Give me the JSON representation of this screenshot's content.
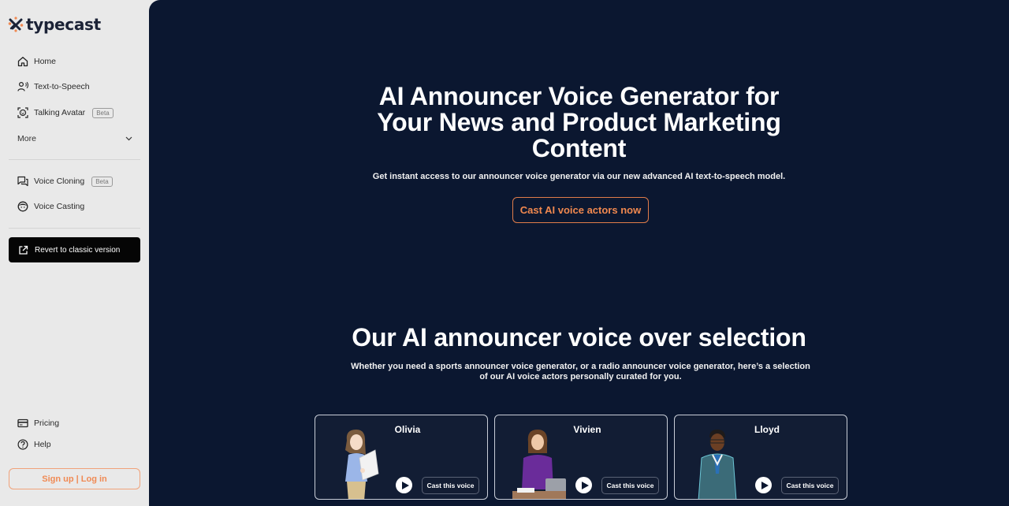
{
  "brand": {
    "name": "typecast",
    "accent": "#f08a54",
    "dark_bg": "#0b1730"
  },
  "sidebar": {
    "primary_items": [
      {
        "label": "Home",
        "icon": "home-icon"
      },
      {
        "label": "Text-to-Speech",
        "icon": "speaker-person-icon"
      },
      {
        "label": "Talking Avatar",
        "icon": "face-scan-icon",
        "badge": "Beta"
      }
    ],
    "more_label": "More",
    "secondary_items": [
      {
        "label": "Voice Cloning",
        "icon": "chat-bubbles-icon",
        "badge": "Beta"
      },
      {
        "label": "Voice Casting",
        "icon": "face-icon"
      }
    ],
    "revert_label": "Revert to classic version",
    "bottom_items": [
      {
        "label": "Pricing",
        "icon": "credit-card-icon"
      },
      {
        "label": "Help",
        "icon": "help-circle-icon"
      }
    ],
    "auth_label": "Sign up | Log in"
  },
  "hero": {
    "title_lines": [
      "AI Announcer Voice Generator for",
      "Your News and Product Marketing",
      "Content"
    ],
    "subtitle": "Get instant access to our announcer voice generator via our new advanced AI text-to-speech model.",
    "cta_label": "Cast AI voice actors now"
  },
  "selection": {
    "title": "Our AI announcer voice over selection",
    "subtitle": "Whether you need a sports announcer voice generator, or a radio announcer voice generator, here’s a selection of our AI voice actors personally curated for you.",
    "cards": [
      {
        "name": "Olivia",
        "cast_label": "Cast this voice"
      },
      {
        "name": "Vivien",
        "cast_label": "Cast this voice"
      },
      {
        "name": "Lloyd",
        "cast_label": "Cast this voice"
      }
    ]
  }
}
